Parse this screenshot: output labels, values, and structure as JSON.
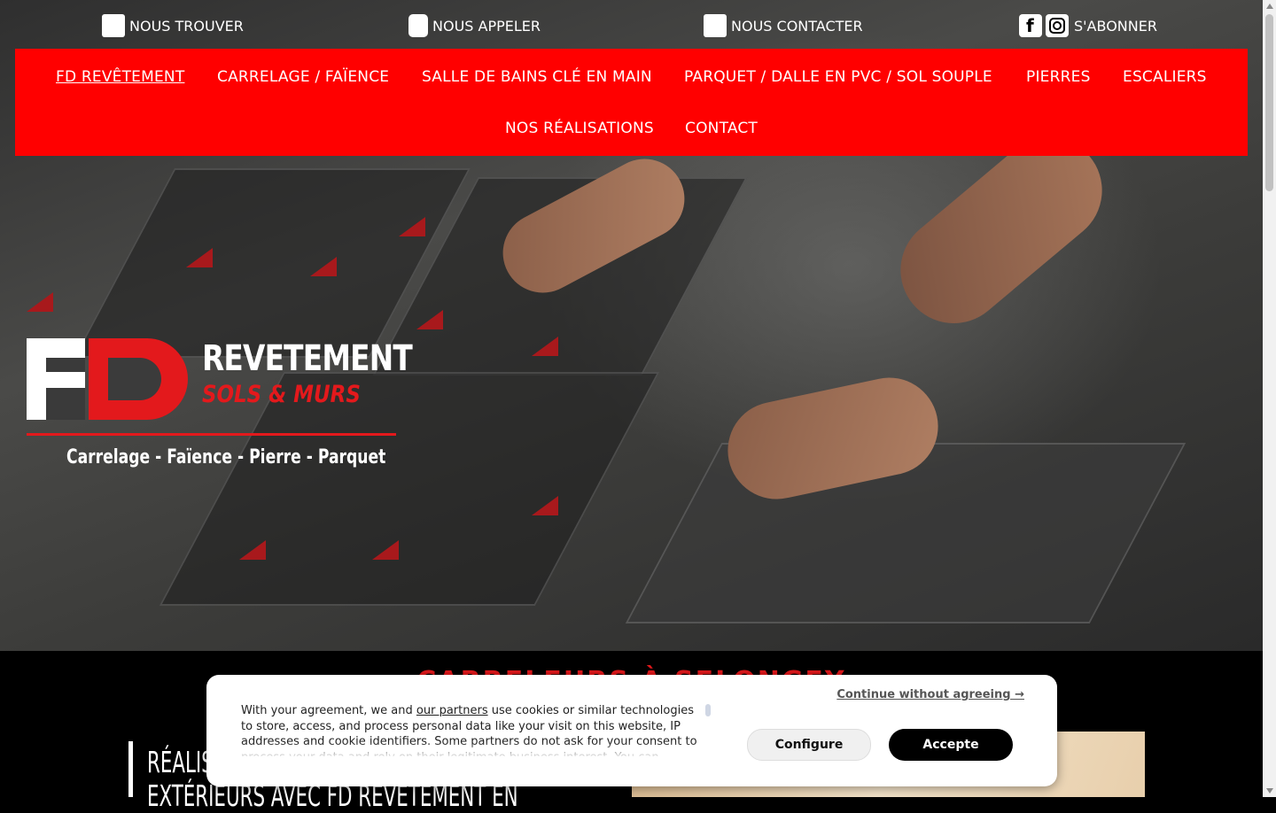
{
  "topbar": {
    "find_label": "NOUS TROUVER",
    "call_label": "NOUS APPELER",
    "contact_label": "NOUS CONTACTER",
    "subscribe_label": "S'ABONNER"
  },
  "nav": {
    "items": [
      {
        "label": "FD REVÊTEMENT",
        "active": true
      },
      {
        "label": "CARRELAGE / FAÏENCE"
      },
      {
        "label": "SALLE DE BAINS CLÉ EN MAIN"
      },
      {
        "label": "PARQUET / DALLE EN PVC / SOL SOUPLE"
      },
      {
        "label": "PIERRES"
      },
      {
        "label": "ESCALIERS"
      },
      {
        "label": "NOS RÉALISATIONS"
      },
      {
        "label": "CONTACT"
      }
    ]
  },
  "logo": {
    "word1": "REVETEMENT",
    "word2": "SOLS & MURS",
    "tagline": "Carrelage - Faïence - Pierre - Parquet"
  },
  "section": {
    "title": "CARRELEURS À SELONGEY",
    "headline_line1": "RÉALISATIONS INTÉRIEURS ET",
    "headline_line2": "EXTÉRIEURS AVEC FD REVÊTEMENT EN"
  },
  "cookie": {
    "continue_label": "Continue without agreeing →",
    "text_before_link": "With your agreement, we and ",
    "partners_link": "our partners",
    "text_after_link": " use cookies or similar technologies to store, access, and process personal data like your visit on this website, IP addresses and cookie identifiers. Some partners do not ask for your consent to process your data and rely on their legitimate business interest. You can",
    "configure_label": "Configure",
    "accept_label": "Accepte"
  },
  "colors": {
    "nav_bg": "#ff0000",
    "brand_red": "#e3191c",
    "accept_bg": "#000000"
  }
}
